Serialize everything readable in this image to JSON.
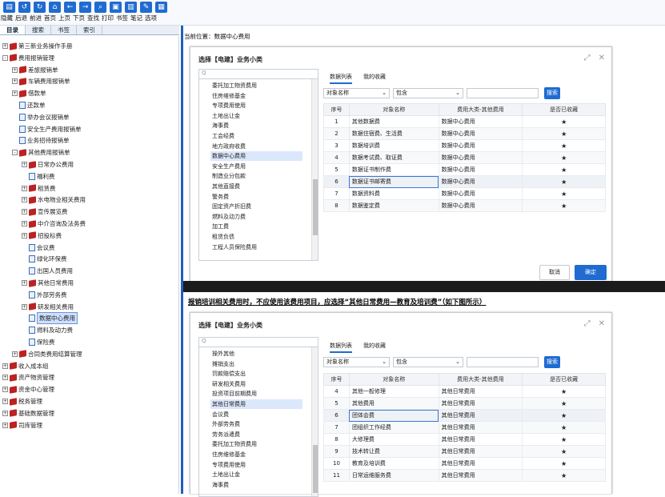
{
  "toolbar": {
    "labels": [
      "隐藏",
      "后退",
      "前进",
      "首页",
      "上页",
      "下页",
      "查找",
      "打印",
      "书签",
      "笔记",
      "选项"
    ]
  },
  "nav_tabs": [
    "目录",
    "搜索",
    "书签",
    "索引"
  ],
  "tree": [
    {
      "label": "第三新业务操作手册",
      "indent": 0,
      "tw": "+",
      "icon": "book"
    },
    {
      "label": "费用报销管理",
      "indent": 0,
      "tw": "-",
      "icon": "book"
    },
    {
      "label": "差旅报销单",
      "indent": 1,
      "tw": "+",
      "icon": "book"
    },
    {
      "label": "车辆费用报销单",
      "indent": 1,
      "tw": "+",
      "icon": "book"
    },
    {
      "label": "借款单",
      "indent": 1,
      "tw": "+",
      "icon": "book"
    },
    {
      "label": "还款单",
      "indent": 1,
      "tw": "",
      "icon": "doc"
    },
    {
      "label": "举办会议报销单",
      "indent": 1,
      "tw": "",
      "icon": "doc"
    },
    {
      "label": "安全生产费用报销单",
      "indent": 1,
      "tw": "",
      "icon": "doc"
    },
    {
      "label": "业务招待报销单",
      "indent": 1,
      "tw": "",
      "icon": "doc"
    },
    {
      "label": "其他费用报销单",
      "indent": 1,
      "tw": "-",
      "icon": "book"
    },
    {
      "label": "日常办公费用",
      "indent": 2,
      "tw": "+",
      "icon": "book"
    },
    {
      "label": "福利费",
      "indent": 2,
      "tw": "",
      "icon": "doc"
    },
    {
      "label": "租赁费",
      "indent": 2,
      "tw": "+",
      "icon": "book"
    },
    {
      "label": "水电物业相关费用",
      "indent": 2,
      "tw": "+",
      "icon": "book"
    },
    {
      "label": "宣传展览费",
      "indent": 2,
      "tw": "+",
      "icon": "book"
    },
    {
      "label": "中介咨询及法务费",
      "indent": 2,
      "tw": "+",
      "icon": "book"
    },
    {
      "label": "招投标费",
      "indent": 2,
      "tw": "+",
      "icon": "book"
    },
    {
      "label": "会议费",
      "indent": 2,
      "tw": "",
      "icon": "doc"
    },
    {
      "label": "绿化环保费",
      "indent": 2,
      "tw": "",
      "icon": "doc"
    },
    {
      "label": "出国人员费用",
      "indent": 2,
      "tw": "",
      "icon": "doc"
    },
    {
      "label": "其他日常费用",
      "indent": 2,
      "tw": "+",
      "icon": "book"
    },
    {
      "label": "外部劳务费",
      "indent": 2,
      "tw": "",
      "icon": "doc"
    },
    {
      "label": "研发相关费用",
      "indent": 2,
      "tw": "+",
      "icon": "book"
    },
    {
      "label": "数据中心费用",
      "indent": 2,
      "tw": "",
      "icon": "doc",
      "selected": true
    },
    {
      "label": "燃料及动力费",
      "indent": 2,
      "tw": "",
      "icon": "doc"
    },
    {
      "label": "保险费",
      "indent": 2,
      "tw": "",
      "icon": "doc"
    },
    {
      "label": "合同类费用结算管理",
      "indent": 1,
      "tw": "+",
      "icon": "book"
    },
    {
      "label": "收入成本组",
      "indent": 0,
      "tw": "+",
      "icon": "book"
    },
    {
      "label": "资产物资管理",
      "indent": 0,
      "tw": "+",
      "icon": "book"
    },
    {
      "label": "资金中心管理",
      "indent": 0,
      "tw": "+",
      "icon": "book"
    },
    {
      "label": "税务管理",
      "indent": 0,
      "tw": "+",
      "icon": "book"
    },
    {
      "label": "基础数据管理",
      "indent": 0,
      "tw": "+",
      "icon": "book"
    },
    {
      "label": "司库管理",
      "indent": 0,
      "tw": "+",
      "icon": "book"
    }
  ],
  "breadcrumb": "当前位置：数据中心费用",
  "dialog1": {
    "title": "选择【电建】业务小类",
    "categories": [
      "委托加工物资费用",
      "住房维修基金",
      "专项费用使用",
      "土地出让金",
      "海事费",
      "工会经费",
      "地方政府收费",
      "数据中心费用",
      "安全生产费用",
      "制造业分包款",
      "其他直接费",
      "警务费",
      "固定资产折旧费",
      "燃料及动力费",
      "加工费",
      "租赁负债",
      "工程人员保险费用"
    ],
    "selected_category": "数据中心费用",
    "tabs": [
      "数据列表",
      "我的收藏"
    ],
    "filter_field": "对象名称",
    "filter_op": "包含",
    "search_btn": "搜索",
    "columns": [
      "序号",
      "对象名称",
      "费用大类-其他费用",
      "是否已收藏"
    ],
    "rows": [
      [
        "1",
        "其他数据费",
        "数据中心费用"
      ],
      [
        "2",
        "数据住宿费、生活费",
        "数据中心费用"
      ],
      [
        "3",
        "数据培训费",
        "数据中心费用"
      ],
      [
        "4",
        "数据考试费、取证费",
        "数据中心费用"
      ],
      [
        "5",
        "数据证书制作费",
        "数据中心费用"
      ],
      [
        "6",
        "数据证书邮寄费",
        "数据中心费用"
      ],
      [
        "7",
        "数据资料费",
        "数据中心费用"
      ],
      [
        "8",
        "数据鉴定费",
        "数据中心费用"
      ]
    ],
    "selected_row": 6,
    "cancel": "取消",
    "confirm": "确定"
  },
  "note": "报销培训相关费用时，不应使用该费用项目，应选择“其他日常费用—教育及培训费”（如下图所示）",
  "dialog2": {
    "title": "选择【电建】业务小类",
    "categories": [
      "操外其他",
      "摊销支出",
      "罚款赔偿支出",
      "研发相关费用",
      "投资项目前期费用",
      "其他日常费用",
      "会议费",
      "外部劳务费",
      "劳务派遣费",
      "委托加工物资费用",
      "住房维修基金",
      "专项费用使用",
      "土地出让金",
      "海事费"
    ],
    "selected_category": "其他日常费用",
    "tabs": [
      "数据列表",
      "我的收藏"
    ],
    "filter_field": "对象名称",
    "filter_op": "包含",
    "search_btn": "搜索",
    "columns": [
      "序号",
      "对象名称",
      "费用大类-其他费用",
      "是否已收藏"
    ],
    "rows": [
      [
        "4",
        "其他一般修理",
        "其他日常费用"
      ],
      [
        "5",
        "其他费用",
        "其他日常费用"
      ],
      [
        "6",
        "团体会费",
        "其他日常费用"
      ],
      [
        "7",
        "团组织工作经费",
        "其他日常费用"
      ],
      [
        "8",
        "大修理费",
        "其他日常费用"
      ],
      [
        "9",
        "技术转让费",
        "其他日常费用"
      ],
      [
        "10",
        "教育及培训费",
        "其他日常费用"
      ],
      [
        "11",
        "日常运维服务费",
        "其他日常费用"
      ]
    ],
    "selected_row": 6
  }
}
